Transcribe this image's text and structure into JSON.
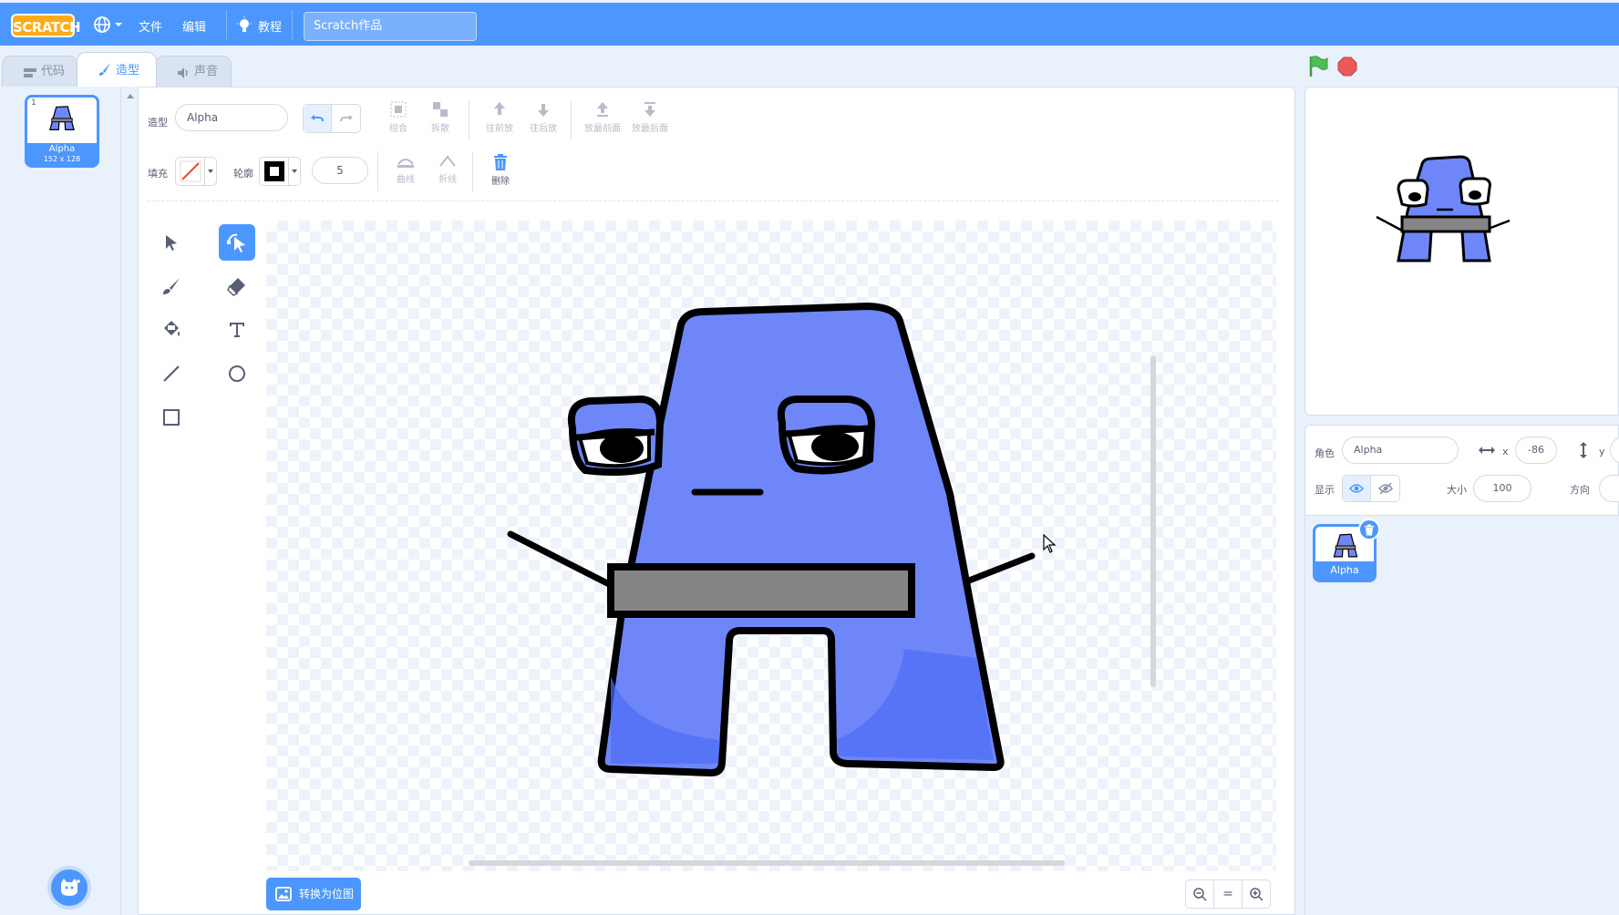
{
  "menubar": {
    "logo_text": "SCRATCH",
    "file_menu": "文件",
    "edit_menu": "编辑",
    "tutorials": "教程",
    "project_title": "Scratch作品"
  },
  "tabs": [
    {
      "label": "代码",
      "icon": "code-icon",
      "active": false
    },
    {
      "label": "造型",
      "icon": "brush-icon",
      "active": true
    },
    {
      "label": "声音",
      "icon": "speaker-icon",
      "active": false
    }
  ],
  "costume_list": {
    "item": {
      "number": "1",
      "name": "Alpha",
      "size": "152 x 128"
    }
  },
  "paint_editor": {
    "costume_label": "造型",
    "costume_name": "Alpha",
    "group": "组合",
    "ungroup": "拆散",
    "forward": "往前放",
    "backward": "往后放",
    "front": "放最前面",
    "back": "放最后面",
    "fill_label": "填充",
    "outline_label": "轮廓",
    "outline_width": "5",
    "curved": "曲线",
    "pointed": "折线",
    "delete": "删除",
    "convert_button": "转换为位图",
    "zoom_reset": "="
  },
  "sprite_info": {
    "sprite_label": "角色",
    "sprite_name": "Alpha",
    "x_label": "x",
    "x_value": "-86",
    "y_label": "y",
    "show_label": "显示",
    "size_label": "大小",
    "size_value": "100",
    "direction_label": "方向"
  },
  "sprites": [
    {
      "name": "Alpha",
      "selected": true
    }
  ],
  "colors": {
    "accent": "#4c97ff",
    "character": "#6e86f7",
    "belt": "#858585",
    "outline": "#000000",
    "fill_swatch_line": "#e84a2f"
  }
}
